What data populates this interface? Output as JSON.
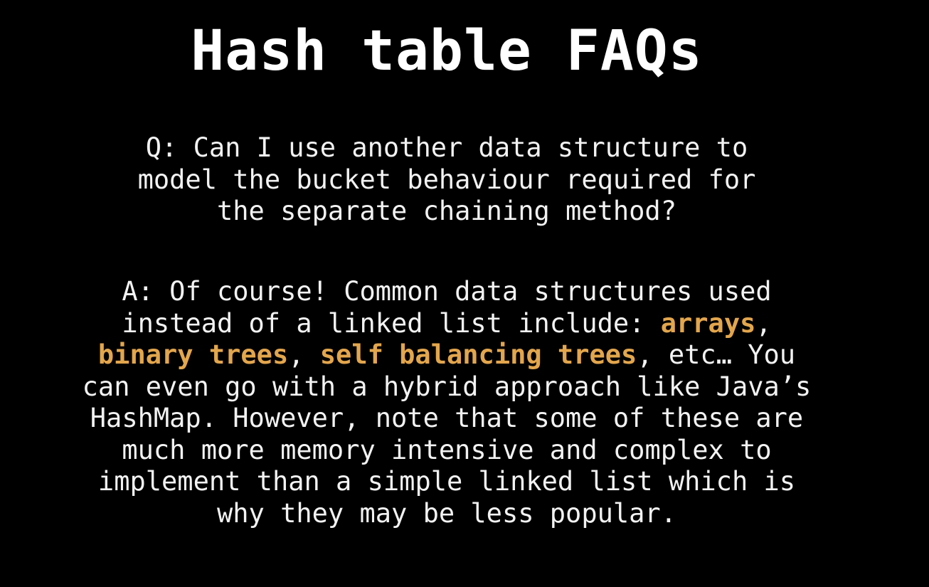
{
  "slide": {
    "title": "Hash table FAQs",
    "accent_color": "#e3a64c",
    "question": {
      "lines": [
        "Q: Can I use another data structure to",
        "model the bucket behaviour required for",
        "the separate chaining method?"
      ]
    },
    "answer": {
      "line1": "A: Of course! Common data structures used",
      "line2_text": "instead of a linked list include: ",
      "hl_arrays": "arrays",
      "line2_end": ",",
      "hl_binary_trees": "binary trees",
      "line3_sep": ", ",
      "hl_self_balancing": "self balancing trees",
      "line3_end": ", etc… You",
      "line4": "can even go with a hybrid approach like Java’s",
      "line5": "HashMap. However, note that some of these are",
      "line6": "much more memory intensive and complex to",
      "line7": "implement than a simple linked list which is",
      "line8": "why they may be less popular."
    }
  }
}
